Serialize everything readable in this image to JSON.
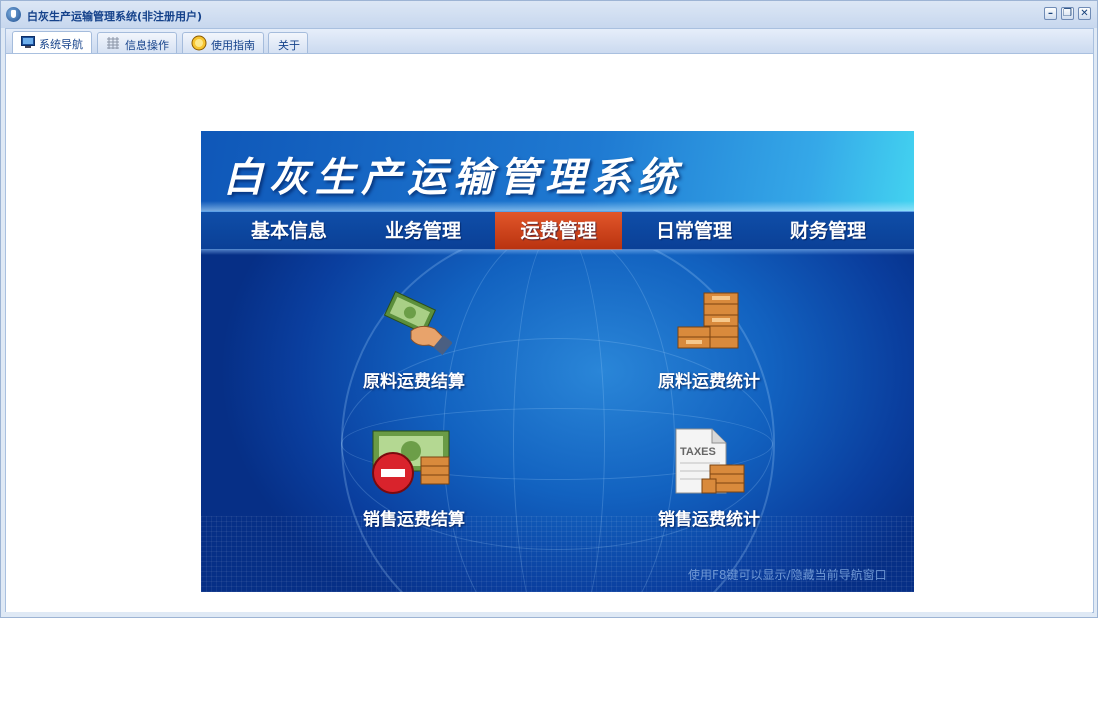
{
  "window": {
    "title": "白灰生产运输管理系统(非注册用户)",
    "controls": {
      "minimize": "–",
      "restore": "❐",
      "close": "✕"
    }
  },
  "tabs": [
    {
      "label": "系统导航",
      "icon": "monitor-icon",
      "active": true
    },
    {
      "label": "信息操作",
      "icon": "grid-icon",
      "active": false
    },
    {
      "label": "使用指南",
      "icon": "guide-icon",
      "active": false
    },
    {
      "label": "关于",
      "icon": "",
      "active": false
    }
  ],
  "panel": {
    "title": "白灰生产运输管理系统",
    "nav": [
      {
        "label": "基本信息",
        "active": false
      },
      {
        "label": "业务管理",
        "active": false
      },
      {
        "label": "运费管理",
        "active": true
      },
      {
        "label": "日常管理",
        "active": false
      },
      {
        "label": "财务管理",
        "active": false
      }
    ],
    "functions": [
      {
        "label": "原料运费结算",
        "icon": "money-hand-icon"
      },
      {
        "label": "原料运费统计",
        "icon": "coin-stack-icon"
      },
      {
        "label": "销售运费结算",
        "icon": "money-minus-icon"
      },
      {
        "label": "销售运费统计",
        "icon": "taxes-document-icon"
      }
    ],
    "tax_doc_text": "TAXES",
    "hint": "使用F8键可以显示/隐藏当前导航窗口"
  },
  "colors": {
    "titlebar_text": "#15428b",
    "nav_active": "#d0441b",
    "panel_blue": "#1262c0"
  }
}
